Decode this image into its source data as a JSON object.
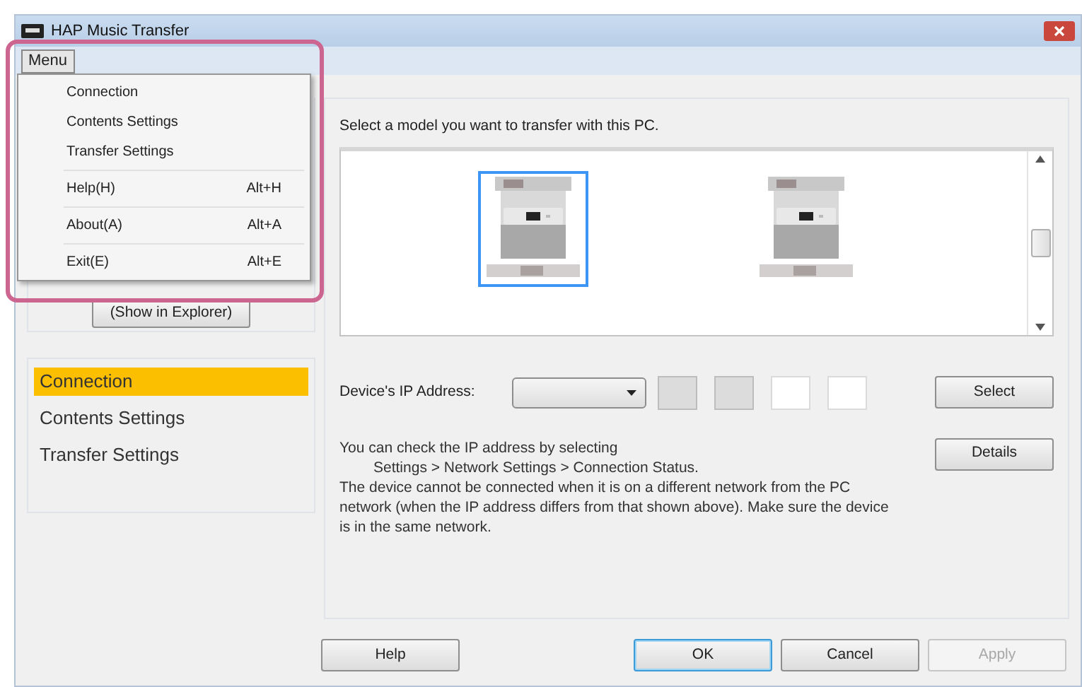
{
  "window": {
    "title": "HAP Music Transfer"
  },
  "menu_bar": [
    {
      "label": "Menu",
      "selected": true
    }
  ],
  "menu": {
    "items": [
      {
        "kind": "item",
        "label": "Connection"
      },
      {
        "kind": "item",
        "label": "Contents Settings"
      },
      {
        "kind": "item",
        "label": "Transfer Settings"
      },
      {
        "kind": "separator"
      },
      {
        "kind": "item",
        "label": "Help(H)",
        "shortcut": "Alt+H"
      },
      {
        "kind": "separator"
      },
      {
        "kind": "item",
        "label": "About(A)",
        "shortcut": "Alt+A"
      },
      {
        "kind": "separator"
      },
      {
        "kind": "item",
        "label": "Exit(E)",
        "shortcut": "Alt+E"
      }
    ]
  },
  "explorer_button": "(Show in Explorer)",
  "sidebar": {
    "items": [
      {
        "label": "Connection",
        "selected": true
      },
      {
        "label": "Contents Settings",
        "selected": false
      },
      {
        "label": "Transfer Settings",
        "selected": false
      }
    ]
  },
  "model_list": {
    "prompt": "Select a model you want to transfer with this PC.",
    "models": [
      {
        "kind": "picture",
        "selected": true
      },
      {
        "kind": "picture",
        "selected": false
      }
    ]
  },
  "ip": {
    "label": "Device's IP Address:",
    "octets": [
      {
        "disabled": true
      },
      {
        "disabled": true
      },
      {
        "disabled": false
      },
      {
        "disabled": false
      }
    ]
  },
  "side_buttons": [
    "Select",
    "Details"
  ],
  "note": [
    {
      "kind": "line",
      "text": "You can check the IP address by selecting"
    },
    {
      "kind": "indented",
      "text": "Settings > Network Settings > Connection Status."
    },
    {
      "kind": "line",
      "text": "The device cannot be connected when it is on a different network from the PC network (when the IP address differs from that shown above). Make sure the device is in the same network."
    }
  ],
  "help_button": "Help",
  "dialog_buttons": [
    {
      "label": "OK",
      "default": true,
      "disabled": false
    },
    {
      "label": "Cancel",
      "default": false,
      "disabled": false
    },
    {
      "label": "Apply",
      "default": false,
      "disabled": true
    }
  ]
}
